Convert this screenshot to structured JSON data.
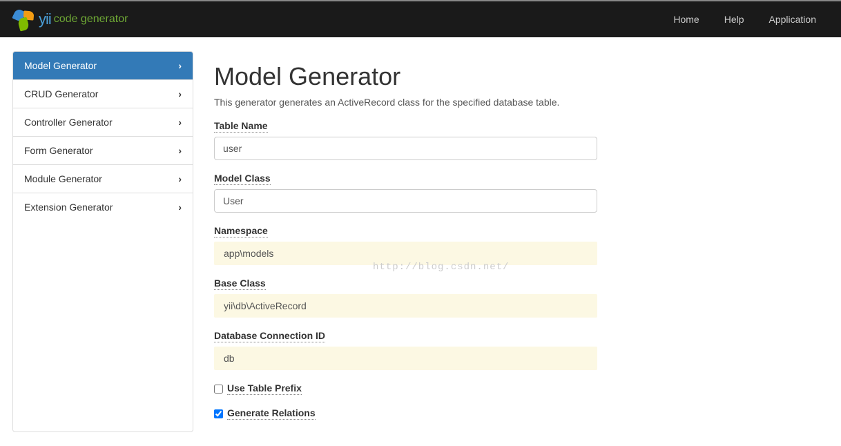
{
  "brand": {
    "name": "yii",
    "sub": "code generator"
  },
  "nav": {
    "home": "Home",
    "help": "Help",
    "application": "Application"
  },
  "sidebar": {
    "items": [
      {
        "label": "Model Generator",
        "active": true
      },
      {
        "label": "CRUD Generator",
        "active": false
      },
      {
        "label": "Controller Generator",
        "active": false
      },
      {
        "label": "Form Generator",
        "active": false
      },
      {
        "label": "Module Generator",
        "active": false
      },
      {
        "label": "Extension Generator",
        "active": false
      }
    ]
  },
  "page": {
    "title": "Model Generator",
    "description": "This generator generates an ActiveRecord class for the specified database table."
  },
  "form": {
    "table_name": {
      "label": "Table Name",
      "value": "user"
    },
    "model_class": {
      "label": "Model Class",
      "value": "User"
    },
    "namespace": {
      "label": "Namespace",
      "value": "app\\models"
    },
    "base_class": {
      "label": "Base Class",
      "value": "yii\\db\\ActiveRecord"
    },
    "db_connection": {
      "label": "Database Connection ID",
      "value": "db"
    },
    "use_table_prefix": {
      "label": "Use Table Prefix",
      "checked": false
    },
    "generate_relations": {
      "label": "Generate Relations",
      "checked": true
    }
  },
  "watermark": "http://blog.csdn.net/"
}
